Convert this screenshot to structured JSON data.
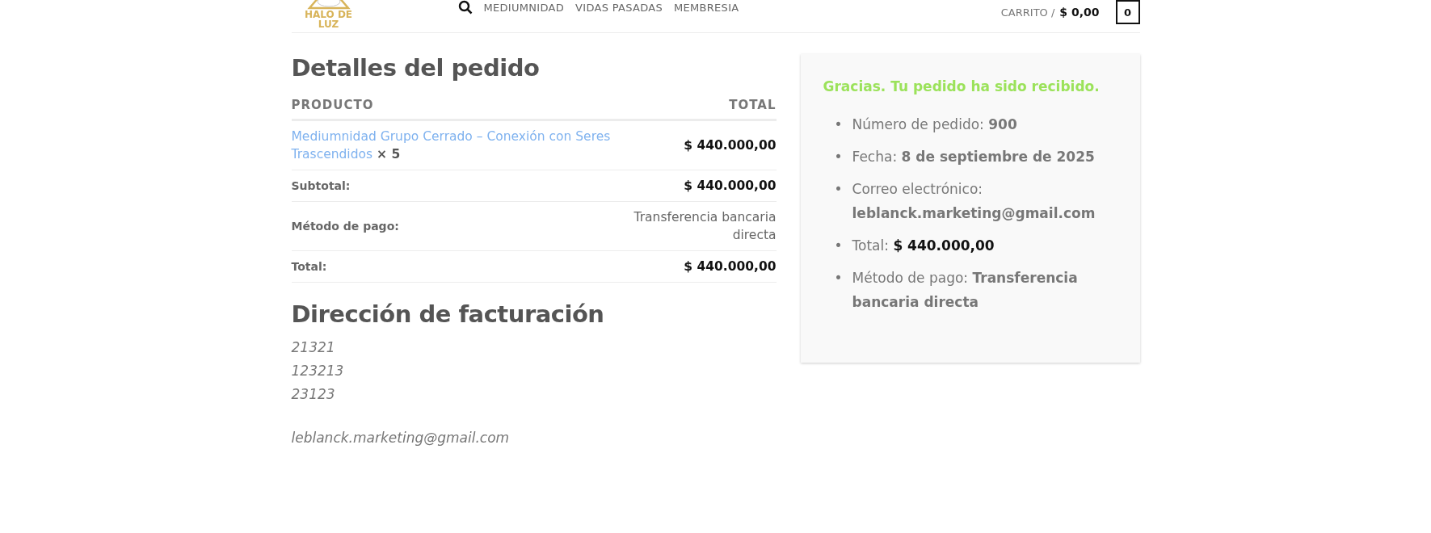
{
  "header": {
    "logo_text": "HALO DE LUZ",
    "nav": [
      "MEDIUMNIDAD",
      "VIDAS PASADAS",
      "MEMBRESIA"
    ],
    "cart_label": "CARRITO /",
    "cart_amount": "$ 0,00",
    "cart_count": "0"
  },
  "order_details": {
    "title": "Detalles del pedido",
    "columns": [
      "PRODUCTO",
      "TOTAL"
    ],
    "product": {
      "name": "Mediumnidad Grupo Cerrado – Conexión con Seres Trascendidos",
      "quantity": "× 5",
      "total": "$ 440.000,00"
    },
    "rows": [
      {
        "label": "Subtotal:",
        "value": "$ 440.000,00",
        "kind": "amount"
      },
      {
        "label": "Método de pago:",
        "value": "Transferencia bancaria directa",
        "kind": "text"
      },
      {
        "label": "Total:",
        "value": "$ 440.000,00",
        "kind": "amount"
      }
    ]
  },
  "billing": {
    "title": "Dirección de facturación",
    "lines": [
      "21321",
      "123213",
      "23123"
    ],
    "email": "leblanck.marketing@gmail.com"
  },
  "summary": {
    "message": "Gracias. Tu pedido ha sido recibido.",
    "items": [
      {
        "marker": "•",
        "label": "Número de pedido:",
        "value": "900",
        "kind": "text"
      },
      {
        "marker": "•",
        "label": "Fecha:",
        "value": "8 de septiembre de 2025",
        "kind": "text"
      },
      {
        "marker": "•",
        "label": "Correo electrónico:",
        "value": "leblanck.marketing@gmail.com",
        "kind": "text"
      },
      {
        "marker": "•",
        "label": "Total:",
        "value": "$ 440.000,00",
        "kind": "amount"
      },
      {
        "marker": "•",
        "label": "Método de pago:",
        "value": "Transferencia bancaria directa",
        "kind": "text"
      }
    ]
  }
}
